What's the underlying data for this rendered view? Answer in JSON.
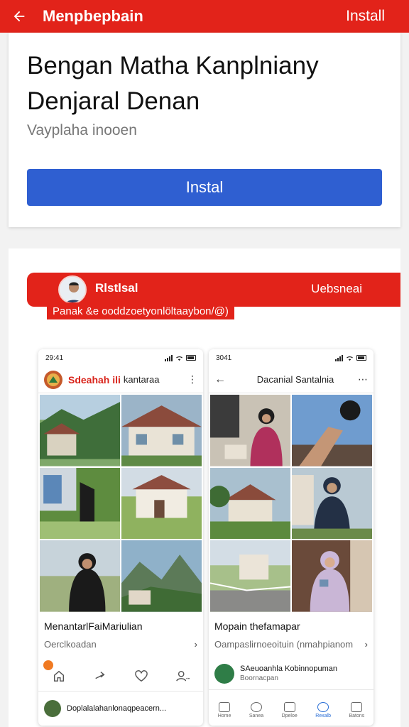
{
  "topbar": {
    "title": "Menpbepbain",
    "install_label": "Install"
  },
  "card1": {
    "headline": "Bengan Matha Kanplniany Denjaral Denan",
    "subtitle": "Vayplaha inooen",
    "install_button": "Instal"
  },
  "card2": {
    "ribbon_name": "Rlstlsal",
    "ribbon_right": "Uebsneai",
    "ribbon_sub": "Panak &e ooddzoetyonlöltaaybon/@)"
  },
  "phone_left": {
    "time": "29:41",
    "title_red": "Sdeahah ili",
    "title_rest": "kantaraa",
    "info_title": "MenantarlFaiMariulian",
    "info_sub": "Oerclkoadan",
    "footer_user": "Doplalalahanlonaqpeacern..."
  },
  "phone_right": {
    "time": "3041",
    "title": "Dacanial Santalnia",
    "info_title": "Mopain thefamapar",
    "info_sub": "Oampaslirnoeoituin (nmahpianom",
    "user_name": "SAeuoanhla Kobinnopuman",
    "user_sub": "Boornacpan",
    "tabs": [
      "Home",
      "Sanea",
      "Dpeloe",
      "Rexalb",
      "Batons"
    ]
  },
  "colors": {
    "brand_red": "#e2231a",
    "button_blue": "#2f5fd1",
    "tab_active": "#2b6fd6"
  },
  "icons": {
    "back": "arrow-left-icon",
    "more": "more-vertical-icon",
    "like": "heart-icon",
    "share": "share-icon",
    "home": "home-icon",
    "user": "user-icon"
  }
}
